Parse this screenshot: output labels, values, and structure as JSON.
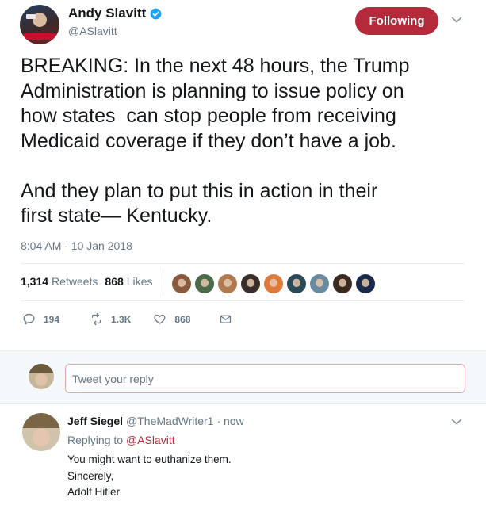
{
  "tweet": {
    "author_name": "Andy Slavitt",
    "author_handle": "@ASlavitt",
    "follow_label": "Following",
    "text": "BREAKING: In the next 48 hours, the Trump\nAdministration is planning to issue policy on\nhow states  can stop people from receiving\nMedicaid coverage if they don’t have a job.\n\nAnd they plan to put this in action in their\nfirst state— Kentucky.",
    "timestamp": "8:04 AM - 10 Jan 2018",
    "retweets_count": "1,314",
    "retweets_label": "Retweets",
    "likes_count": "868",
    "likes_label": "Likes",
    "actions": {
      "reply_count": "194",
      "retweet_count": "1.3K",
      "like_count": "868"
    },
    "liker_face_colors": [
      "#8a5a3c",
      "#4a6a4a",
      "#b0794f",
      "#3a2e2a",
      "#e07a3a",
      "#2a4a5a",
      "#6a8aa0",
      "#3a2a20",
      "#1b2a4a"
    ]
  },
  "reply_box": {
    "placeholder": "Tweet your reply"
  },
  "reply": {
    "author_name": "Jeff Siegel",
    "author_handle": "@TheMadWriter1",
    "time": "· now",
    "replying_prefix": "Replying to",
    "replying_to": "@ASlavitt",
    "line1": "You might want to euthanize them.",
    "line2": "Sincerely,",
    "line3": "Adolf Hitler"
  },
  "colors": {
    "accent": "#b52a3a",
    "muted": "#657786",
    "verified": "#1da1f2"
  }
}
